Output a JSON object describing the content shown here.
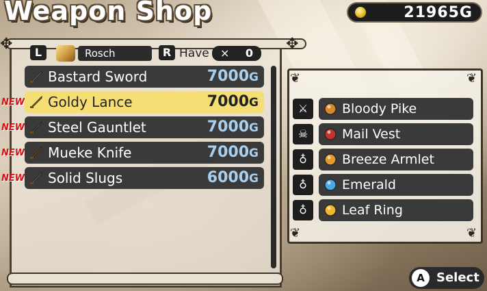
{
  "header": {
    "title": "Weapon Shop",
    "money": "21965G",
    "money_icon": "coin-icon"
  },
  "character": {
    "left_button": "L",
    "right_button": "R",
    "name": "Rosch",
    "have_label": "Have",
    "have_x": "×",
    "have_count": "0"
  },
  "shop_items": [
    {
      "name": "Bastard Sword",
      "price": "7000",
      "currency": "G",
      "new": false,
      "selected": false,
      "icon": "sword-icon",
      "icon_color": "#d8d8d8"
    },
    {
      "name": "Goldy Lance",
      "price": "7000",
      "currency": "G",
      "new": true,
      "selected": true,
      "icon": "lance-icon",
      "icon_color": "#e9c23b"
    },
    {
      "name": "Steel Gauntlet",
      "price": "7000",
      "currency": "G",
      "new": true,
      "selected": false,
      "icon": "gauntlet-icon",
      "icon_color": "#e07a2c"
    },
    {
      "name": "Mueke Knife",
      "price": "7000",
      "currency": "G",
      "new": true,
      "selected": false,
      "icon": "knife-icon",
      "icon_color": "#f0a030"
    },
    {
      "name": "Solid Slugs",
      "price": "6000",
      "currency": "G",
      "new": true,
      "selected": false,
      "icon": "gun-icon",
      "icon_color": "#a8c8e0"
    }
  ],
  "new_label": "NEW",
  "equipment": [
    {
      "slot_icon": "weapon-slot-icon",
      "slot_glyph": "⚔",
      "name": "Bloody Pike",
      "icon": "pike-icon",
      "icon_color": "#d88a2a"
    },
    {
      "slot_icon": "armor-slot-icon",
      "slot_glyph": "☠",
      "name": "Mail Vest",
      "icon": "vest-icon",
      "icon_color": "#c0342a"
    },
    {
      "slot_icon": "accessory-slot-icon",
      "slot_glyph": "♁",
      "name": "Breeze Armlet",
      "icon": "armlet-icon",
      "icon_color": "#e39a2e"
    },
    {
      "slot_icon": "accessory-slot-icon",
      "slot_glyph": "♁",
      "name": "Emerald",
      "icon": "gem-icon",
      "icon_color": "#4aa8e8"
    },
    {
      "slot_icon": "accessory-slot-icon",
      "slot_glyph": "♁",
      "name": "Leaf Ring",
      "icon": "ring-icon",
      "icon_color": "#f2b52e"
    }
  ],
  "footer": {
    "button": "A",
    "label": "Select"
  }
}
